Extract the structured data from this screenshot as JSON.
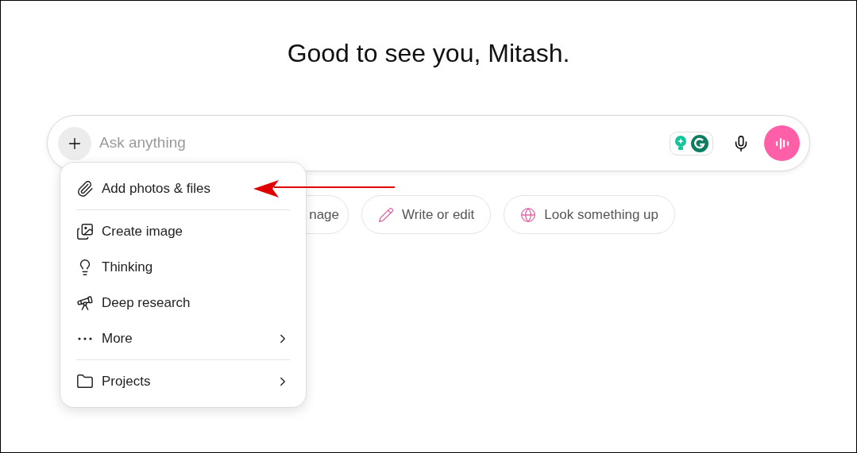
{
  "greeting": "Good to see you, Mitash.",
  "composer": {
    "placeholder": "Ask anything"
  },
  "chips": [
    {
      "kind": "partial",
      "label": "nage"
    },
    {
      "kind": "pencil",
      "label": "Write or edit"
    },
    {
      "kind": "globe",
      "label": "Look something up"
    }
  ],
  "menu": {
    "sections": [
      {
        "items": [
          {
            "kind": "clip",
            "label": "Add photos & files",
            "submenu": false
          }
        ]
      },
      {
        "items": [
          {
            "kind": "image",
            "label": "Create image",
            "submenu": false
          },
          {
            "kind": "bulb",
            "label": "Thinking",
            "submenu": false
          },
          {
            "kind": "telescope",
            "label": "Deep research",
            "submenu": false
          },
          {
            "kind": "dots",
            "label": "More",
            "submenu": true
          }
        ]
      },
      {
        "items": [
          {
            "kind": "folder",
            "label": "Projects",
            "submenu": true
          }
        ]
      }
    ]
  }
}
